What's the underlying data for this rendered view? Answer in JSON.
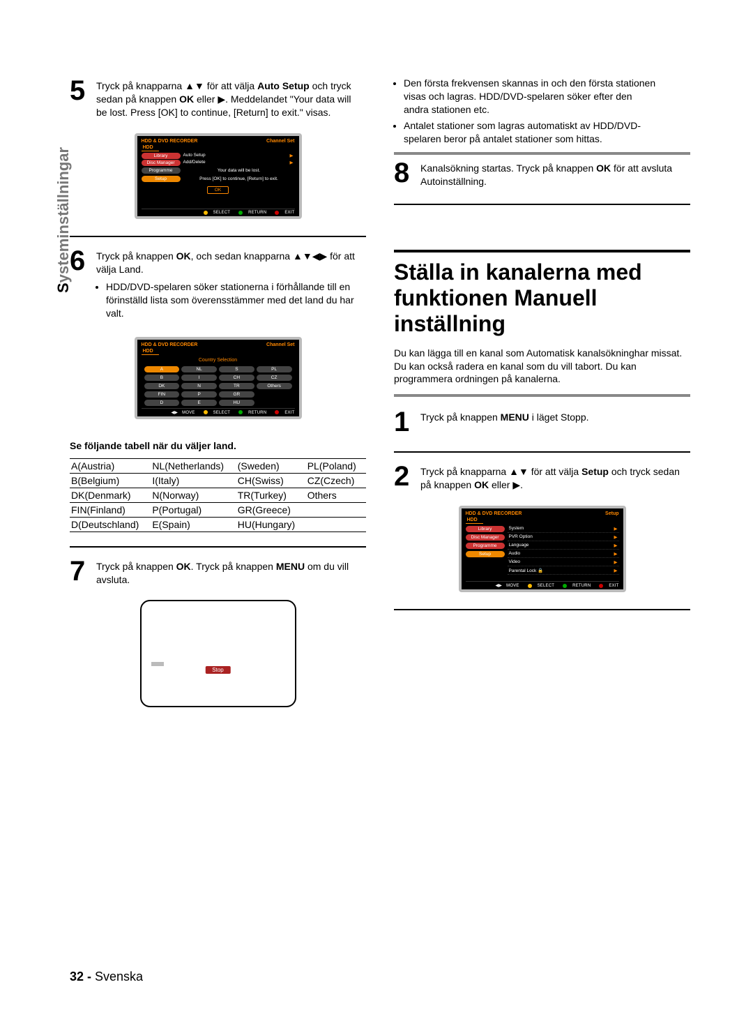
{
  "sidetab": {
    "first": "S",
    "rest": "ysteminställningar"
  },
  "left": {
    "step5_num": "5",
    "step5_html_parts": {
      "a": "Tryck på knapparna ▲▼ för att välja ",
      "b": "Auto Setup",
      "c": " och tryck sedan på knappen ",
      "d": "OK",
      "e": " eller ▶. Meddelandet \"Your data will be lost. Press [OK] to continue, [Return] to exit.\" visas."
    },
    "step6_num": "6",
    "step6": {
      "a": "Tryck på knappen ",
      "b": "OK",
      "c": ", och sedan knapparna ▲▼◀▶ för att välja Land.",
      "bullet": "HDD/DVD-spelaren söker stationerna i förhållande till en förinställd lista som överensstämmer med det land du har valt."
    },
    "table_caption": "Se följande tabell när du väljer land.",
    "country_table": [
      [
        "A(Austria)",
        "NL(Netherlands)",
        "(Sweden)",
        "PL(Poland)"
      ],
      [
        "B(Belgium)",
        "I(Italy)",
        "CH(Swiss)",
        "CZ(Czech)"
      ],
      [
        "DK(Denmark)",
        "N(Norway)",
        "TR(Turkey)",
        "Others"
      ],
      [
        "FIN(Finland)",
        "P(Portugal)",
        "GR(Greece)",
        ""
      ],
      [
        "D(Deutschland)",
        "E(Spain)",
        "HU(Hungary)",
        ""
      ]
    ],
    "step7_num": "7",
    "step7": {
      "a": "Tryck på knappen ",
      "b": "OK",
      "c": ". Tryck på knappen ",
      "d": "MENU",
      "e": " om du vill avsluta."
    }
  },
  "right": {
    "bullet1": "Den första frekvensen skannas in och den första stationen visas och lagras. HDD/DVD-spelaren söker efter den andra stationen etc.",
    "bullet2": "Antalet stationer som lagras automatiskt av HDD/DVD-spelaren beror på antalet stationer som hittas.",
    "step8_num": "8",
    "step8": {
      "a": "Kanalsökning startas. Tryck på knappen ",
      "b": "OK",
      "c": " för att avsluta Autoinställning."
    },
    "heading": "Ställa in kanalerna med funktionen Manuell inställning",
    "blurb": "Du kan lägga till en kanal som Automatisk kanalsökninghar missat. Du kan också radera en kanal som du vill tabort. Du kan programmera ordningen på kanalerna.",
    "step1_num": "1",
    "step1": {
      "a": "Tryck på knappen ",
      "b": "MENU",
      "c": " i läget Stopp."
    },
    "step2_num": "2",
    "step2": {
      "a": "Tryck på knapparna ▲▼ för att välja ",
      "b": "Setup",
      "c": " och tryck sedan på knappen ",
      "d": "OK",
      "e": " eller ▶."
    }
  },
  "osd": {
    "brand": "HDD & DVD RECORDER",
    "hdd": "HDD",
    "channel_set": "Channel Set",
    "setup": "Setup",
    "left_menu": [
      "Library",
      "Disc Manager",
      "Programme",
      "Setup"
    ],
    "s5_right": [
      "Auto Setup",
      "Add/Delete"
    ],
    "s5_dialog1": "Your data will be lost.",
    "s5_dialog2": "Press [OK] to continue, [Return] to exit.",
    "ok": "OK",
    "footer_move": "MOVE",
    "footer_select": "SELECT",
    "footer_return": "RETURN",
    "footer_exit": "EXIT",
    "country_title": "Country Selection",
    "country_grid": [
      [
        "A",
        "NL",
        "S",
        "PL"
      ],
      [
        "B",
        "I",
        "CH",
        "CZ"
      ],
      [
        "DK",
        "N",
        "TR",
        "Others"
      ],
      [
        "FIN",
        "P",
        "GR",
        ""
      ],
      [
        "D",
        "E",
        "HU",
        ""
      ]
    ],
    "s2_right": [
      "System",
      "PVR Option",
      "Language",
      "Audio",
      "Video",
      "Parental Lock 🔒"
    ],
    "stop": "Stop"
  },
  "footer": {
    "page": "32",
    "sep": " - ",
    "lang": "Svenska"
  }
}
